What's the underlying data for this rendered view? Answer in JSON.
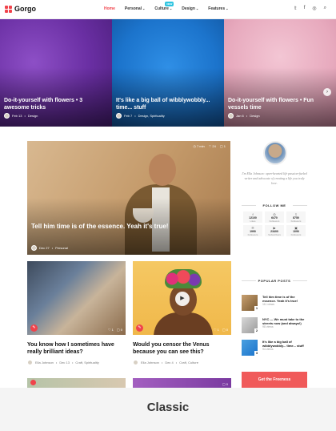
{
  "site": {
    "name": "Gorgo"
  },
  "nav": {
    "items": [
      "Home",
      "Personal",
      "Culture",
      "Design",
      "Features"
    ],
    "badge": "NEW"
  },
  "social_icons": [
    "twitter-icon",
    "facebook-icon",
    "instagram-icon",
    "search-icon"
  ],
  "slides": [
    {
      "title": "Do-it-yourself with flowers • 3 awesome tricks",
      "date": "Feb 13",
      "category": "Design"
    },
    {
      "title": "It's like a big ball of wibblywobbly... time... stuff",
      "date": "Feb 7",
      "category": "Design, Spirituality"
    },
    {
      "title": "Do-it-yourself with flowers • Fun vessels time",
      "date": "Jan 6",
      "category": "Design"
    }
  ],
  "feature": {
    "stats": {
      "time": "7 min",
      "likes": "24",
      "comments": "1"
    },
    "title": "Tell him time is of the essence. Yeah it's true!",
    "date": "Dec 27",
    "category": "Personal"
  },
  "cards": [
    {
      "title": "You know how I sometimes have really brilliant ideas?",
      "author": "Ella Johnson",
      "date": "Dec 13",
      "category": "Craft, Spirituality",
      "stats": [
        "1",
        "0"
      ]
    },
    {
      "title": "Would you censor the Venus because you can see this?",
      "author": "Ella Johnson",
      "date": "Dec 4",
      "category": "Craft, Culture",
      "stats": [
        "1",
        "0"
      ]
    }
  ],
  "strip_stats": [
    "0"
  ],
  "sidebar": {
    "about": "I'm Ella Johnson: open-hearted life passion-fueled writer and advocate of creating a life you truly love.",
    "follow_title": "FOLLOW ME",
    "follow": [
      {
        "icon": "facebook-icon",
        "count": "12100",
        "label": "Likes"
      },
      {
        "icon": "instagram-icon",
        "count": "6470",
        "label": "Followers"
      },
      {
        "icon": "twitter-icon",
        "count": "8750",
        "label": "Followers"
      },
      {
        "icon": "pinterest-icon",
        "count": "1990",
        "label": "Followers"
      },
      {
        "icon": "youtube-icon",
        "count": "23400",
        "label": "Subscribers"
      },
      {
        "icon": "twitch-icon",
        "count": "1090",
        "label": "Followers"
      }
    ],
    "popular_title": "POPULAR POSTS",
    "popular": [
      {
        "num": "1",
        "title": "Tell him time is of the essence. Yeah it's true!",
        "views": "111 views"
      },
      {
        "num": "2",
        "title": "NYC — We must take to the streets now (and always!)",
        "views": "98 views"
      },
      {
        "num": "3",
        "title": "It's like a big ball of wibblywobbly... time... stuff",
        "views": "94 views"
      }
    ],
    "cta": "Get the Freeness"
  },
  "caption": "Classic",
  "colors": {
    "accent": "#f0434b",
    "badge": "#2ec4e0"
  }
}
